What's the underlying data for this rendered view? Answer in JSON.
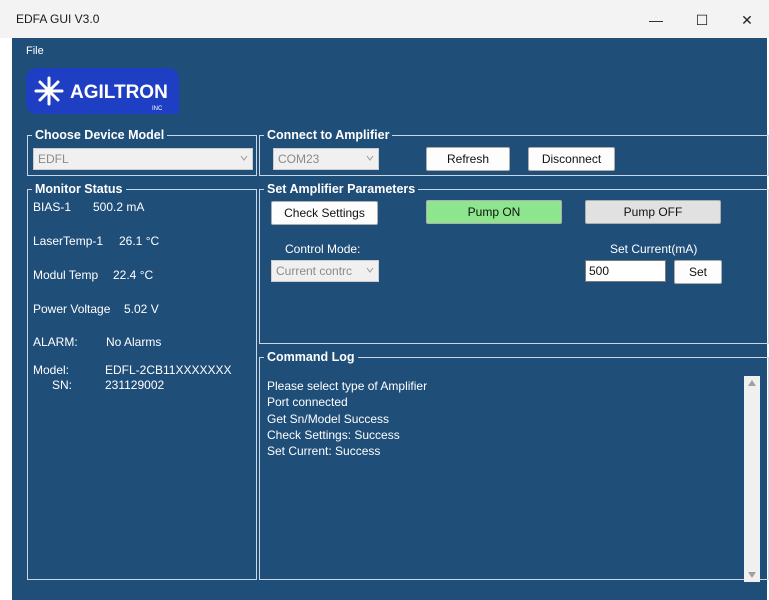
{
  "window": {
    "title": "EDFA GUI V3.0",
    "minimize": "—",
    "maximize": "☐",
    "close": "✕"
  },
  "menu": {
    "file": "File"
  },
  "logo": {
    "text": "AGILTRON",
    "subtext": "INC"
  },
  "device_model": {
    "legend": "Choose Device Model",
    "value": "EDFL"
  },
  "connect": {
    "legend": "Connect to Amplifier",
    "port": "COM23",
    "refresh": "Refresh",
    "disconnect": "Disconnect"
  },
  "monitor": {
    "legend": "Monitor Status",
    "bias_label": "BIAS-1",
    "bias_value": "500.2 mA",
    "lasertemp_label": "LaserTemp-1",
    "lasertemp_value": "26.1 °C",
    "modultemp_label": "Modul Temp",
    "modultemp_value": "22.4 °C",
    "power_label": "Power Voltage",
    "power_value": "5.02 V",
    "alarm_label": "ALARM:",
    "alarm_value": "No Alarms",
    "model_label": "Model:",
    "model_value": "EDFL-2CB11XXXXXXX",
    "sn_label": "SN:",
    "sn_value": "231129002"
  },
  "params": {
    "legend": "Set Amplifier Parameters",
    "check_settings": "Check Settings",
    "pump_on": "Pump ON",
    "pump_off": "Pump OFF",
    "control_mode_label": "Control Mode:",
    "control_mode_value": "Current contrc",
    "set_current_label": "Set Current(mA)",
    "set_current_value": "500",
    "set_button": "Set"
  },
  "command_log": {
    "legend": "Command Log",
    "lines": [
      "Please select type of Amplifier",
      "Port connected",
      "Get Sn/Model Success",
      "Check Settings: Success",
      "Set Current: Success"
    ]
  },
  "colors": {
    "app_bg": "#1f4e79",
    "pump_on_bg": "#8de68d",
    "logo_bg": "#1e3fc4"
  }
}
